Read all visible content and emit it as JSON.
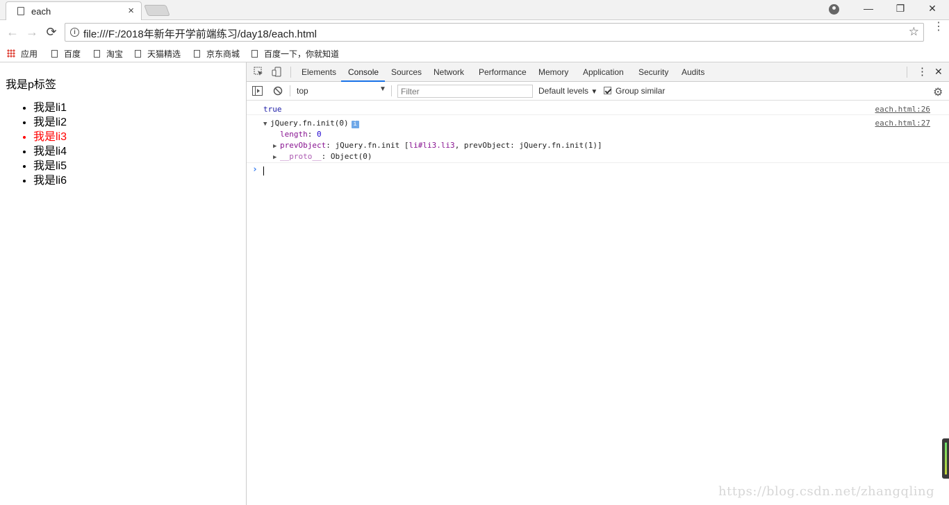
{
  "tab": {
    "title": "each",
    "close": "×"
  },
  "window": {
    "minimize": "—",
    "restore": "❐",
    "close": "✕"
  },
  "toolbar": {
    "back": "←",
    "forward": "→",
    "reload": "⟳",
    "url": "file:///F:/2018年新年开学前端练习/day18/each.html",
    "star": "☆",
    "menu": "⋮"
  },
  "bookmarks": [
    {
      "label": "应用",
      "icon": "apps-grid-icon"
    },
    {
      "label": "百度",
      "icon": "document-icon"
    },
    {
      "label": "淘宝",
      "icon": "document-icon"
    },
    {
      "label": "天猫精选",
      "icon": "document-icon"
    },
    {
      "label": "京东商城",
      "icon": "document-icon"
    },
    {
      "label": "百度一下，你就知道",
      "icon": "document-icon"
    }
  ],
  "page": {
    "paragraph": "我是p标签",
    "items": [
      "我是li1",
      "我是li2",
      "我是li3",
      "我是li4",
      "我是li5",
      "我是li6"
    ],
    "highlight_color": "#ff0000"
  },
  "devtools": {
    "tabs": [
      "Elements",
      "Console",
      "Sources",
      "Network",
      "Performance",
      "Memory",
      "Application",
      "Security",
      "Audits"
    ],
    "selected_tab": "Console",
    "context": "top",
    "filter_placeholder": "Filter",
    "levels": "Default levels",
    "group_similar": "Group similar",
    "more": "⋮",
    "close": "✕",
    "gear": "⚙",
    "accent": "#1a73e8"
  },
  "console": {
    "line1": {
      "value": "true",
      "source": "each.html:26"
    },
    "line2": {
      "head": "jQuery.fn.init(0)",
      "badge": "i",
      "source": "each.html:27",
      "length_key": "length",
      "length_val": "0",
      "prev_key": "prevObject",
      "prev_val_a": "jQuery.fn.init [",
      "prev_val_b": "li#li3.li3",
      "prev_val_c": ", prevObject: jQuery.fn.init(1)]",
      "proto_key": "__proto__",
      "proto_val": "Object(0)"
    },
    "prompt": "›"
  },
  "watermark": "https://blog.csdn.net/zhangqling"
}
